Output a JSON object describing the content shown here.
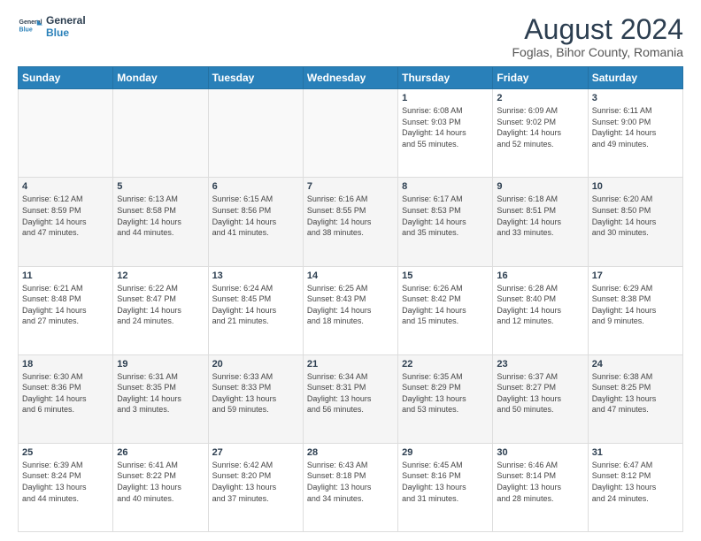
{
  "logo": {
    "line1": "General",
    "line2": "Blue"
  },
  "title": "August 2024",
  "subtitle": "Foglas, Bihor County, Romania",
  "days_header": [
    "Sunday",
    "Monday",
    "Tuesday",
    "Wednesday",
    "Thursday",
    "Friday",
    "Saturday"
  ],
  "weeks": [
    [
      {
        "day": "",
        "info": ""
      },
      {
        "day": "",
        "info": ""
      },
      {
        "day": "",
        "info": ""
      },
      {
        "day": "",
        "info": ""
      },
      {
        "day": "1",
        "info": "Sunrise: 6:08 AM\nSunset: 9:03 PM\nDaylight: 14 hours\nand 55 minutes."
      },
      {
        "day": "2",
        "info": "Sunrise: 6:09 AM\nSunset: 9:02 PM\nDaylight: 14 hours\nand 52 minutes."
      },
      {
        "day": "3",
        "info": "Sunrise: 6:11 AM\nSunset: 9:00 PM\nDaylight: 14 hours\nand 49 minutes."
      }
    ],
    [
      {
        "day": "4",
        "info": "Sunrise: 6:12 AM\nSunset: 8:59 PM\nDaylight: 14 hours\nand 47 minutes."
      },
      {
        "day": "5",
        "info": "Sunrise: 6:13 AM\nSunset: 8:58 PM\nDaylight: 14 hours\nand 44 minutes."
      },
      {
        "day": "6",
        "info": "Sunrise: 6:15 AM\nSunset: 8:56 PM\nDaylight: 14 hours\nand 41 minutes."
      },
      {
        "day": "7",
        "info": "Sunrise: 6:16 AM\nSunset: 8:55 PM\nDaylight: 14 hours\nand 38 minutes."
      },
      {
        "day": "8",
        "info": "Sunrise: 6:17 AM\nSunset: 8:53 PM\nDaylight: 14 hours\nand 35 minutes."
      },
      {
        "day": "9",
        "info": "Sunrise: 6:18 AM\nSunset: 8:51 PM\nDaylight: 14 hours\nand 33 minutes."
      },
      {
        "day": "10",
        "info": "Sunrise: 6:20 AM\nSunset: 8:50 PM\nDaylight: 14 hours\nand 30 minutes."
      }
    ],
    [
      {
        "day": "11",
        "info": "Sunrise: 6:21 AM\nSunset: 8:48 PM\nDaylight: 14 hours\nand 27 minutes."
      },
      {
        "day": "12",
        "info": "Sunrise: 6:22 AM\nSunset: 8:47 PM\nDaylight: 14 hours\nand 24 minutes."
      },
      {
        "day": "13",
        "info": "Sunrise: 6:24 AM\nSunset: 8:45 PM\nDaylight: 14 hours\nand 21 minutes."
      },
      {
        "day": "14",
        "info": "Sunrise: 6:25 AM\nSunset: 8:43 PM\nDaylight: 14 hours\nand 18 minutes."
      },
      {
        "day": "15",
        "info": "Sunrise: 6:26 AM\nSunset: 8:42 PM\nDaylight: 14 hours\nand 15 minutes."
      },
      {
        "day": "16",
        "info": "Sunrise: 6:28 AM\nSunset: 8:40 PM\nDaylight: 14 hours\nand 12 minutes."
      },
      {
        "day": "17",
        "info": "Sunrise: 6:29 AM\nSunset: 8:38 PM\nDaylight: 14 hours\nand 9 minutes."
      }
    ],
    [
      {
        "day": "18",
        "info": "Sunrise: 6:30 AM\nSunset: 8:36 PM\nDaylight: 14 hours\nand 6 minutes."
      },
      {
        "day": "19",
        "info": "Sunrise: 6:31 AM\nSunset: 8:35 PM\nDaylight: 14 hours\nand 3 minutes."
      },
      {
        "day": "20",
        "info": "Sunrise: 6:33 AM\nSunset: 8:33 PM\nDaylight: 13 hours\nand 59 minutes."
      },
      {
        "day": "21",
        "info": "Sunrise: 6:34 AM\nSunset: 8:31 PM\nDaylight: 13 hours\nand 56 minutes."
      },
      {
        "day": "22",
        "info": "Sunrise: 6:35 AM\nSunset: 8:29 PM\nDaylight: 13 hours\nand 53 minutes."
      },
      {
        "day": "23",
        "info": "Sunrise: 6:37 AM\nSunset: 8:27 PM\nDaylight: 13 hours\nand 50 minutes."
      },
      {
        "day": "24",
        "info": "Sunrise: 6:38 AM\nSunset: 8:25 PM\nDaylight: 13 hours\nand 47 minutes."
      }
    ],
    [
      {
        "day": "25",
        "info": "Sunrise: 6:39 AM\nSunset: 8:24 PM\nDaylight: 13 hours\nand 44 minutes."
      },
      {
        "day": "26",
        "info": "Sunrise: 6:41 AM\nSunset: 8:22 PM\nDaylight: 13 hours\nand 40 minutes."
      },
      {
        "day": "27",
        "info": "Sunrise: 6:42 AM\nSunset: 8:20 PM\nDaylight: 13 hours\nand 37 minutes."
      },
      {
        "day": "28",
        "info": "Sunrise: 6:43 AM\nSunset: 8:18 PM\nDaylight: 13 hours\nand 34 minutes."
      },
      {
        "day": "29",
        "info": "Sunrise: 6:45 AM\nSunset: 8:16 PM\nDaylight: 13 hours\nand 31 minutes."
      },
      {
        "day": "30",
        "info": "Sunrise: 6:46 AM\nSunset: 8:14 PM\nDaylight: 13 hours\nand 28 minutes."
      },
      {
        "day": "31",
        "info": "Sunrise: 6:47 AM\nSunset: 8:12 PM\nDaylight: 13 hours\nand 24 minutes."
      }
    ]
  ]
}
